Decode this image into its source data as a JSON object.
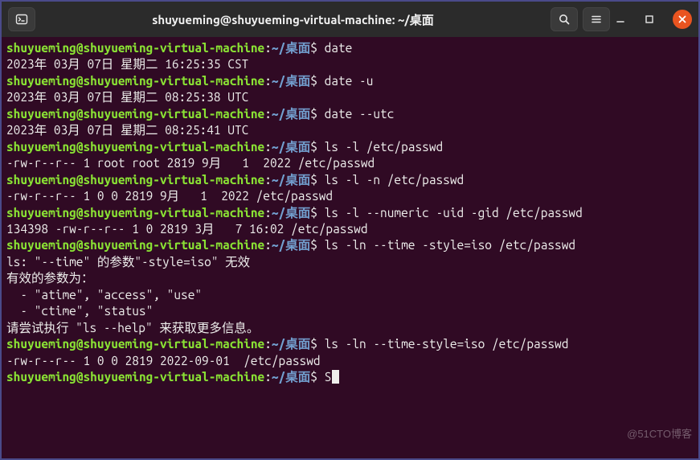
{
  "titlebar": {
    "title": "shuyueming@shuyueming-virtual-machine: ~/桌面"
  },
  "prompt": {
    "user": "shuyueming",
    "at": "@",
    "host": "shuyueming-virtual-machine",
    "colon": ":",
    "path": "~/桌面",
    "dollar": "$"
  },
  "lines": {
    "cmd1": " date",
    "out1": "2023年 03月 07日 星期二 16:25:35 CST",
    "cmd2": " date -u",
    "out2": "2023年 03月 07日 星期二 08:25:38 UTC",
    "cmd3": " date --utc",
    "out3": "2023年 03月 07日 星期二 08:25:41 UTC",
    "cmd4": " ls -l /etc/passwd",
    "out4": "-rw-r--r-- 1 root root 2819 9月   1  2022 /etc/passwd",
    "cmd5": " ls -l -n /etc/passwd",
    "out5": "-rw-r--r-- 1 0 0 2819 9月   1  2022 /etc/passwd",
    "cmd6": " ls -l --numeric -uid -gid /etc/passwd",
    "out6": "134398 -rw-r--r-- 1 0 2819 3月   7 16:02 /etc/passwd",
    "cmd7": " ls -ln --time -style=iso /etc/passwd",
    "err7a": "ls: \"--time\" 的参数\"-style=iso\" 无效",
    "err7b": "有效的参数为：",
    "err7c": "  - \"atime\", \"access\", \"use\"",
    "err7d": "  - \"ctime\", \"status\"",
    "err7e": "请尝试执行 \"ls --help\" 来获取更多信息。",
    "cmd8": " ls -ln --time-style=iso /etc/passwd",
    "out8": "-rw-r--r-- 1 0 0 2819 2022-09-01  /etc/passwd",
    "cmd9": " S"
  },
  "watermark": "@51CTO博客"
}
